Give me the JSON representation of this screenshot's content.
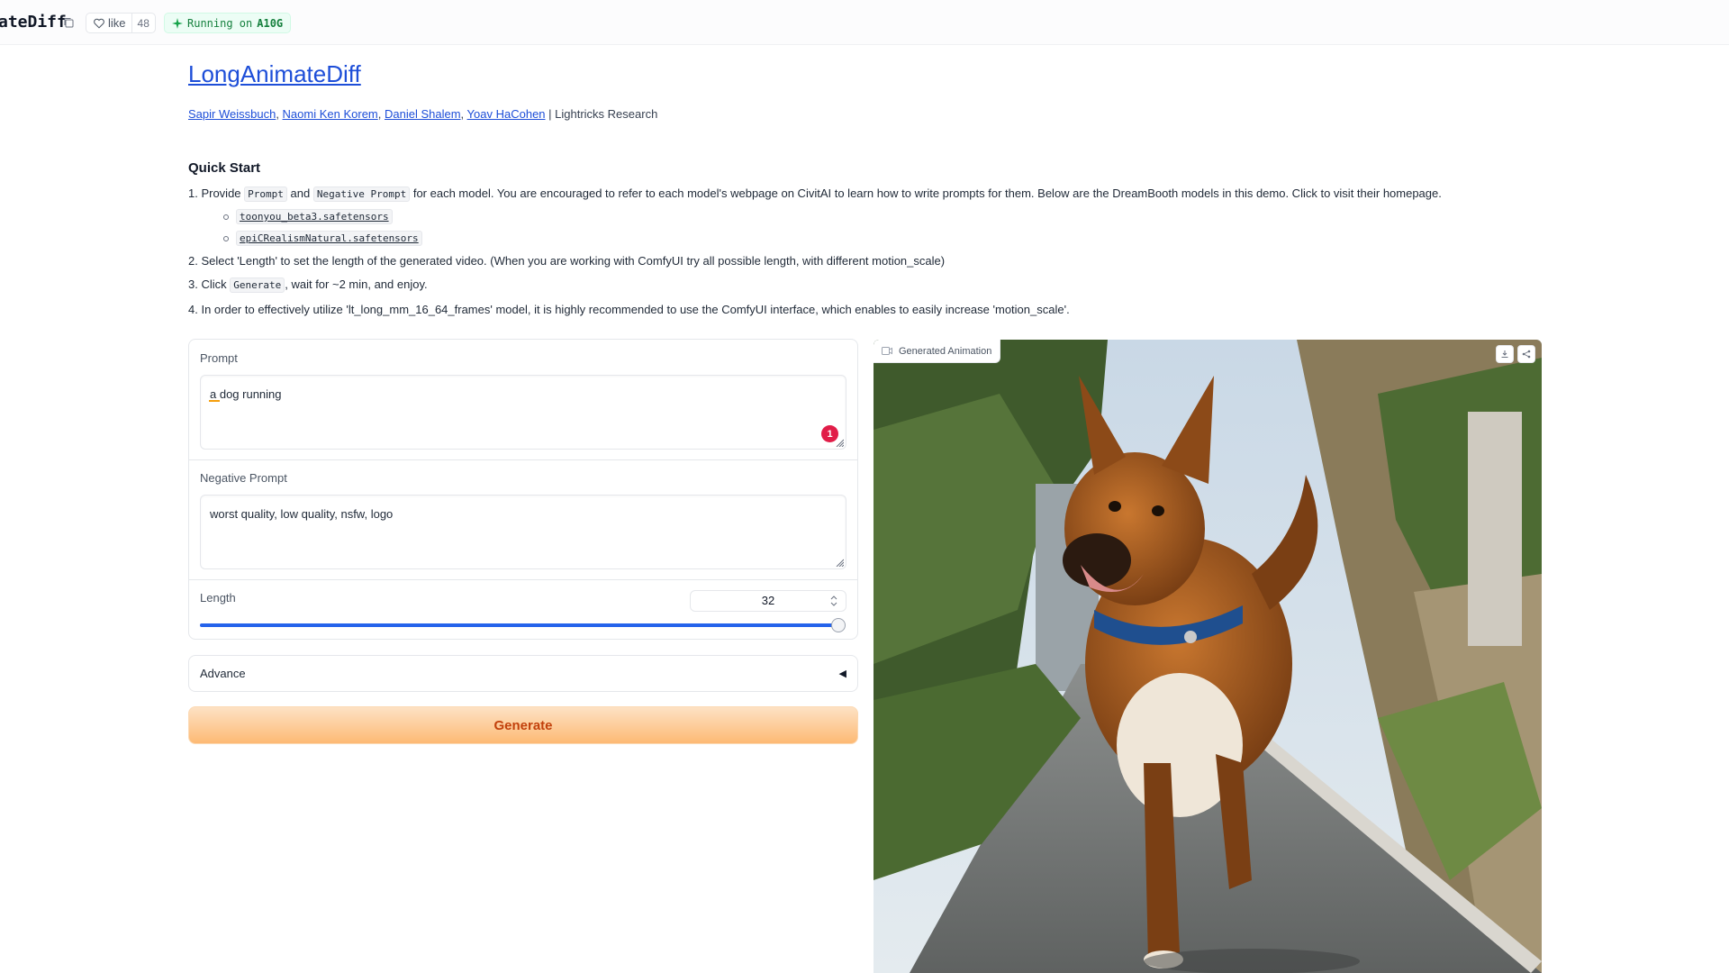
{
  "header": {
    "space_name": "ateDiff",
    "like_label": "like",
    "like_count": "48",
    "running_prefix": "Running on",
    "hardware": "A10G"
  },
  "page": {
    "title": "LongAnimateDiff",
    "authors": [
      "Sapir Weissbuch",
      "Naomi Ken Korem",
      "Daniel Shalem",
      "Yoav HaCohen"
    ],
    "affiliation": "| Lightricks Research"
  },
  "quick_start": {
    "heading": "Quick Start",
    "step1": {
      "pre": "1. Provide",
      "code1": "Prompt",
      "mid": "and",
      "code2": "Negative Prompt",
      "post": "for each model. You are encouraged to refer to each model's webpage on CivitAI to learn how to write prompts for them. Below are the DreamBooth models in this demo. Click to visit their homepage."
    },
    "models": [
      "toonyou_beta3.safetensors",
      "epiCRealismNatural.safetensors"
    ],
    "step2": "2. Select 'Length' to set the length of the generated video. (When you are working with ComfyUI try all possible length, with different motion_scale)",
    "step3": {
      "pre": "3. Click",
      "code": "Generate",
      "post": ", wait for ~2 min, and enjoy."
    },
    "step4": "4. In order to effectively utilize 'lt_long_mm_16_64_frames' model, it is highly recommended to use the ComfyUI interface, which enables to easily increase 'motion_scale'."
  },
  "form": {
    "prompt_label": "Prompt",
    "prompt_value": "a dog running",
    "prompt_error_count": "1",
    "negative_label": "Negative Prompt",
    "negative_value": "worst quality, low quality, nsfw, logo",
    "length_label": "Length",
    "length_value": "32",
    "length_fraction": 1.0,
    "advance_label": "Advance",
    "generate_label": "Generate"
  },
  "output": {
    "label": "Generated Animation"
  },
  "colors": {
    "link": "#1d4ed8",
    "accent_orange": "#fdba74",
    "slider": "#2563eb",
    "error": "#e11d48"
  }
}
